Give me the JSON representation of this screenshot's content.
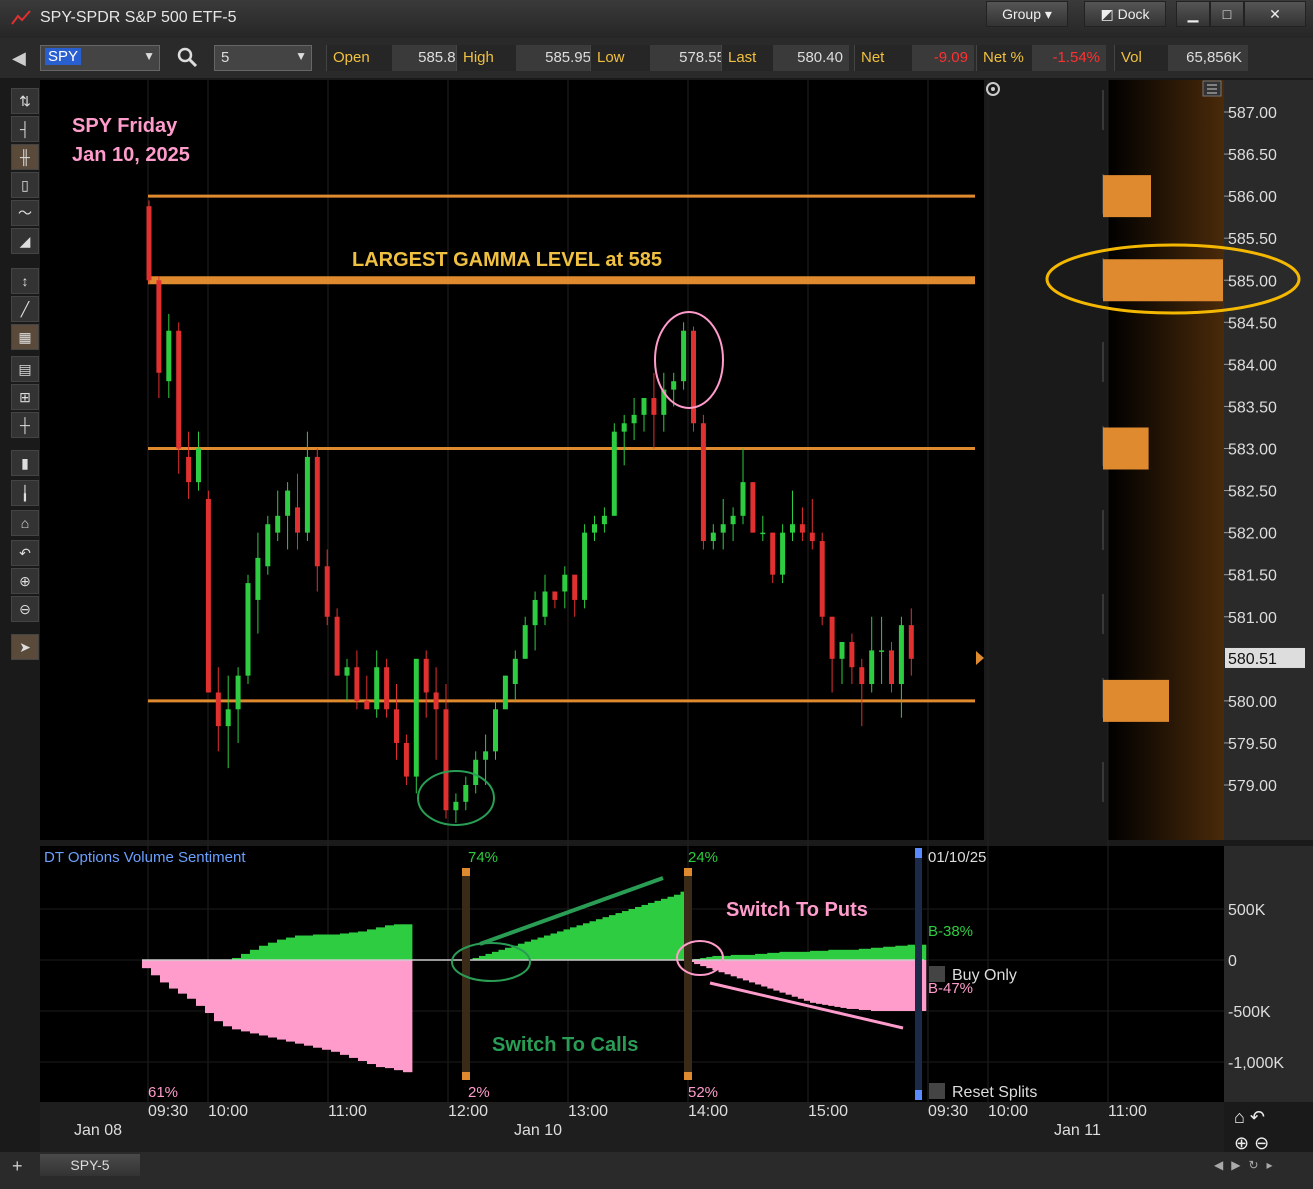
{
  "window": {
    "title": "SPY-SPDR S&P 500 ETF-5",
    "group_label": "Group",
    "dock_label": "Dock",
    "minimize": "▁",
    "maximize": "□",
    "close": "✕"
  },
  "toolbar": {
    "symbol": "SPY",
    "interval": "5",
    "quote": [
      {
        "label": "Open",
        "value": "585.88",
        "color": "#dddddd"
      },
      {
        "label": "High",
        "value": "585.95",
        "color": "#dddddd"
      },
      {
        "label": "Low",
        "value": "578.55",
        "color": "#dddddd"
      },
      {
        "label": "Last",
        "value": "580.40",
        "color": "#dddddd"
      },
      {
        "label": "Net",
        "value": "-9.09",
        "color": "#ff3030"
      },
      {
        "label": "Net %",
        "value": "-1.54%",
        "color": "#ff3030"
      },
      {
        "label": "Vol",
        "value": "65,856K",
        "color": "#dddddd"
      }
    ]
  },
  "tab": {
    "label": "SPY-5"
  },
  "colors": {
    "bull": "#2ecc40",
    "bear": "#e03030",
    "level": "#e08a30",
    "gamma_text": "#f0c040",
    "pink": "#ff9ccc",
    "green_ann": "#2a9d55",
    "ellipse_gold": "#f5b800"
  },
  "chart_data": [
    {
      "type": "candlestick",
      "annotation_title": [
        "SPY Friday",
        "Jan 10, 2025"
      ],
      "gamma_text": "LARGEST GAMMA LEVEL at 585",
      "ylim": [
        578.3,
        587.3
      ],
      "y_ticks": [
        "587.00",
        "586.50",
        "586.00",
        "585.50",
        "585.00",
        "584.50",
        "584.00",
        "583.50",
        "583.00",
        "582.50",
        "582.00",
        "581.50",
        "581.00",
        "580.00",
        "579.50",
        "579.00"
      ],
      "last_price_tag": "580.51",
      "levels": [
        586.0,
        585.0,
        583.0,
        580.0
      ],
      "gamma_bars": [
        {
          "price": 586.0,
          "size": 0.4
        },
        {
          "price": 585.0,
          "size": 1.0
        },
        {
          "price": 583.0,
          "size": 0.38
        },
        {
          "price": 580.0,
          "size": 0.55
        }
      ],
      "x_ticks": [
        "09:30",
        "10:00",
        "11:00",
        "12:00",
        "13:00",
        "14:00",
        "15:00",
        "09:30",
        "10:00",
        "11:00"
      ],
      "x_dates": [
        "Jan 08",
        "Jan 10",
        "Jan 11"
      ],
      "candles": [
        [
          585.88,
          585.95,
          584.95,
          585.0
        ],
        [
          585.0,
          585.05,
          583.6,
          583.9
        ],
        [
          583.8,
          584.6,
          583.6,
          584.4
        ],
        [
          584.4,
          584.5,
          582.7,
          583.0
        ],
        [
          582.9,
          583.2,
          582.4,
          582.6
        ],
        [
          582.6,
          583.2,
          582.5,
          583.0
        ],
        [
          582.4,
          582.5,
          580.1,
          580.1
        ],
        [
          580.1,
          580.4,
          579.4,
          579.7
        ],
        [
          579.7,
          580.3,
          579.2,
          579.9
        ],
        [
          579.9,
          580.4,
          579.5,
          580.3
        ],
        [
          580.3,
          581.5,
          580.2,
          581.4
        ],
        [
          581.2,
          582.0,
          580.8,
          581.7
        ],
        [
          581.6,
          582.2,
          581.5,
          582.1
        ],
        [
          582.0,
          582.5,
          581.9,
          582.2
        ],
        [
          582.2,
          582.6,
          581.8,
          582.5
        ],
        [
          582.3,
          582.7,
          581.8,
          582.0
        ],
        [
          582.0,
          583.2,
          581.9,
          582.9
        ],
        [
          582.9,
          583.0,
          581.3,
          581.6
        ],
        [
          581.6,
          581.8,
          580.9,
          581.0
        ],
        [
          581.0,
          581.1,
          580.3,
          580.3
        ],
        [
          580.3,
          580.5,
          580.0,
          580.4
        ],
        [
          580.4,
          580.6,
          579.9,
          580.0
        ],
        [
          580.0,
          580.3,
          579.9,
          579.9
        ],
        [
          579.9,
          580.6,
          579.8,
          580.4
        ],
        [
          580.4,
          580.5,
          579.8,
          579.9
        ],
        [
          579.9,
          580.2,
          579.3,
          579.5
        ],
        [
          579.5,
          579.6,
          579.0,
          579.1
        ],
        [
          579.1,
          580.5,
          578.9,
          580.5
        ],
        [
          580.5,
          580.6,
          579.8,
          580.1
        ],
        [
          580.1,
          580.4,
          579.3,
          579.9
        ],
        [
          579.9,
          580.2,
          578.6,
          578.7
        ],
        [
          578.7,
          578.9,
          578.55,
          578.8
        ],
        [
          578.8,
          579.1,
          578.7,
          579.0
        ],
        [
          579.0,
          579.4,
          578.9,
          579.3
        ],
        [
          579.3,
          579.6,
          579.0,
          579.4
        ],
        [
          579.4,
          580.0,
          579.3,
          579.9
        ],
        [
          579.9,
          580.3,
          579.9,
          580.3
        ],
        [
          580.2,
          580.6,
          580.0,
          580.5
        ],
        [
          580.5,
          581.0,
          580.5,
          580.9
        ],
        [
          580.9,
          581.3,
          580.6,
          581.2
        ],
        [
          581.0,
          581.5,
          580.9,
          581.3
        ],
        [
          581.3,
          581.3,
          581.1,
          581.2
        ],
        [
          581.3,
          581.6,
          581.1,
          581.5
        ],
        [
          581.5,
          581.5,
          581.0,
          581.2
        ],
        [
          581.2,
          582.1,
          581.1,
          582.0
        ],
        [
          582.0,
          582.2,
          581.9,
          582.1
        ],
        [
          582.1,
          582.3,
          582.0,
          582.2
        ],
        [
          582.2,
          583.3,
          582.2,
          583.2
        ],
        [
          583.2,
          583.4,
          582.8,
          583.3
        ],
        [
          583.3,
          583.6,
          583.1,
          583.4
        ],
        [
          583.4,
          583.6,
          583.2,
          583.6
        ],
        [
          583.6,
          583.9,
          583.0,
          583.4
        ],
        [
          583.4,
          583.9,
          583.2,
          583.7
        ],
        [
          583.7,
          583.9,
          583.5,
          583.8
        ],
        [
          583.8,
          584.5,
          583.7,
          584.4
        ],
        [
          584.4,
          584.45,
          583.2,
          583.3
        ],
        [
          583.3,
          583.4,
          581.8,
          581.9
        ],
        [
          581.9,
          582.1,
          581.8,
          582.0
        ],
        [
          582.0,
          582.4,
          581.8,
          582.1
        ],
        [
          582.1,
          582.3,
          581.9,
          582.2
        ],
        [
          582.2,
          583.0,
          582.1,
          582.6
        ],
        [
          582.6,
          582.6,
          582.0,
          582.0
        ],
        [
          582.0,
          582.2,
          581.9,
          582.0
        ],
        [
          582.0,
          582.0,
          581.4,
          581.5
        ],
        [
          581.5,
          582.1,
          581.4,
          582.0
        ],
        [
          582.0,
          582.5,
          581.9,
          582.1
        ],
        [
          582.1,
          582.3,
          581.9,
          582.0
        ],
        [
          582.0,
          582.4,
          581.8,
          581.9
        ],
        [
          581.9,
          582.0,
          580.9,
          581.0
        ],
        [
          581.0,
          581.0,
          580.1,
          580.5
        ],
        [
          580.5,
          580.7,
          580.2,
          580.7
        ],
        [
          580.7,
          580.8,
          580.2,
          580.4
        ],
        [
          580.4,
          580.5,
          579.7,
          580.2
        ],
        [
          580.2,
          581.0,
          580.1,
          580.6
        ],
        [
          580.6,
          581.0,
          580.2,
          580.6
        ],
        [
          580.6,
          580.7,
          580.1,
          580.2
        ],
        [
          580.2,
          581.0,
          579.8,
          580.9
        ],
        [
          580.9,
          581.1,
          580.3,
          580.5
        ]
      ]
    },
    {
      "type": "area",
      "title": "DT Options Volume Sentiment",
      "ylim": [
        -1100,
        1000
      ],
      "y_ticks": [
        "500K",
        "0",
        "-500K",
        "-1,000K"
      ],
      "y_tick_values": [
        500,
        0,
        -500,
        -1000
      ],
      "calls_pct_labels": [
        "74%",
        "24%"
      ],
      "puts_pct_labels": [
        "61%",
        "2%",
        "52%"
      ],
      "date_label": "01/10/25",
      "buy_pct": "B-38%",
      "sell_pct": "B-47%",
      "buy_only_label": "Buy Only",
      "reset_label": "Reset Splits",
      "switch_calls": "Switch To Calls",
      "switch_puts": "Switch To Puts",
      "segments": [
        {
          "calls": [
            0,
            0,
            0,
            0,
            0,
            0,
            0,
            0,
            0,
            0,
            20,
            60,
            100,
            140,
            170,
            200,
            220,
            240,
            240,
            250,
            250,
            250,
            260,
            270,
            280,
            300,
            320,
            340,
            350,
            350
          ],
          "puts": [
            -80,
            -150,
            -220,
            -280,
            -330,
            -380,
            -450,
            -520,
            -600,
            -650,
            -680,
            -700,
            -720,
            -740,
            -760,
            -780,
            -800,
            -820,
            -840,
            -860,
            -880,
            -900,
            -930,
            -960,
            -990,
            -1020,
            -1050,
            -1060,
            -1080,
            -1100
          ]
        },
        {
          "calls": [
            0,
            20,
            40,
            60,
            80,
            100,
            120,
            140,
            160,
            180,
            200,
            220,
            240,
            260,
            280,
            300,
            320,
            340,
            360,
            380,
            400,
            420,
            440,
            460,
            480,
            500,
            520,
            540,
            560,
            580,
            600,
            620,
            640,
            670
          ],
          "puts": [
            0,
            0,
            0,
            0,
            0,
            0,
            0,
            0,
            0,
            0,
            0,
            0,
            0,
            0,
            0,
            0,
            0,
            0,
            0,
            0,
            0,
            0,
            0,
            0,
            0,
            0,
            0,
            0,
            0,
            0,
            0,
            0,
            0,
            0
          ]
        },
        {
          "calls": [
            0,
            10,
            20,
            30,
            40,
            40,
            40,
            50,
            50,
            50,
            50,
            60,
            60,
            70,
            70,
            80,
            80,
            80,
            80,
            80,
            90,
            90,
            90,
            100,
            100,
            100,
            100,
            100,
            110,
            110,
            120,
            120,
            130,
            130,
            140,
            140,
            150,
            150,
            150
          ],
          "puts": [
            -20,
            -40,
            -60,
            -80,
            -100,
            -120,
            -140,
            -160,
            -180,
            -200,
            -220,
            -240,
            -260,
            -280,
            -300,
            -320,
            -340,
            -360,
            -380,
            -400,
            -420,
            -430,
            -440,
            -450,
            -460,
            -470,
            -480,
            -480,
            -490,
            -490,
            -500,
            -500,
            -500,
            -500,
            -500,
            -500,
            -500,
            -500,
            -500
          ]
        }
      ]
    }
  ]
}
